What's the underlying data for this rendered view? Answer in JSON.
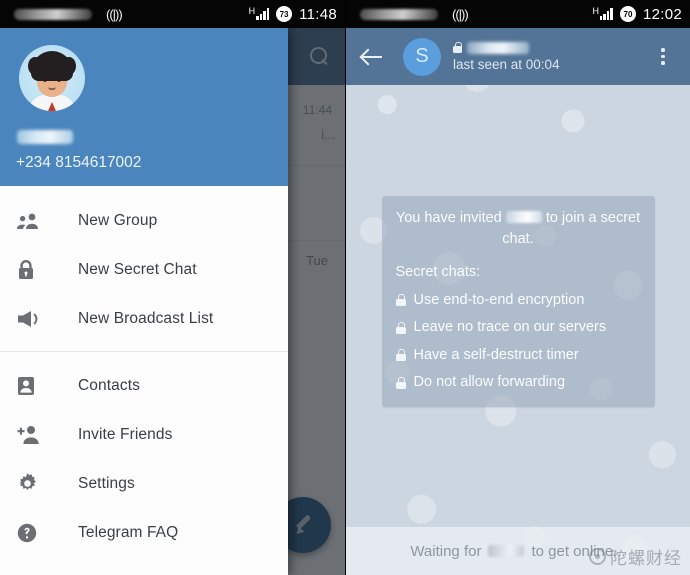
{
  "left_phone": {
    "status_bar": {
      "carrier_blurred": true,
      "wifi_icon": "wifi-icon",
      "network_type": "H",
      "signal_icon": "signal-bars-icon",
      "battery_level": "73",
      "time": "11:48"
    },
    "chat_list": {
      "search_icon": "search-icon",
      "rows": [
        {
          "time": "11:44",
          "snippet": "i..."
        },
        {
          "time": "Tue",
          "snippet": ""
        }
      ],
      "compose_fab_icon": "pencil-icon"
    },
    "drawer": {
      "avatar_icon": "user-avatar",
      "name_blurred": true,
      "phone": "+234 8154617002",
      "items_top": [
        {
          "icon": "group-icon",
          "label": "New Group"
        },
        {
          "icon": "lock-icon",
          "label": "New Secret Chat"
        },
        {
          "icon": "megaphone-icon",
          "label": "New Broadcast List"
        }
      ],
      "items_bottom": [
        {
          "icon": "contact-card-icon",
          "label": "Contacts"
        },
        {
          "icon": "add-person-icon",
          "label": "Invite Friends"
        },
        {
          "icon": "gear-icon",
          "label": "Settings"
        },
        {
          "icon": "question-mark-icon",
          "label": "Telegram FAQ"
        }
      ]
    }
  },
  "right_phone": {
    "status_bar": {
      "carrier_blurred": true,
      "wifi_icon": "wifi-icon",
      "network_type": "H",
      "signal_icon": "signal-bars-icon",
      "battery_level": "70",
      "time": "12:02"
    },
    "chat_header": {
      "back_icon": "back-arrow-icon",
      "avatar_initial": "S",
      "lock_icon": "lock-icon",
      "contact_name_blurred": true,
      "status": "last seen at 00:04",
      "overflow_icon": "more-vertical-icon"
    },
    "service_message": {
      "intro_before": "You have invited",
      "intro_after": "to join a secret chat.",
      "heading": "Secret chats:",
      "bullets": [
        {
          "icon": "lock-icon",
          "text": "Use end-to-end encryption"
        },
        {
          "icon": "lock-icon",
          "text": "Leave no trace on our servers"
        },
        {
          "icon": "lock-icon",
          "text": "Have a self-destruct timer"
        },
        {
          "icon": "lock-icon",
          "text": "Do not allow forwarding"
        }
      ]
    },
    "waiting_bar": {
      "before": "Waiting for",
      "after": "to get online..."
    },
    "watermark": {
      "logo_icon": "circle-logo-icon",
      "text": "陀螺财经"
    }
  },
  "colors": {
    "drawer_header_blue": "#4b85bd",
    "chat_header_blue": "#537496",
    "chatlist_toolbar_blue": "#5b7c9d",
    "chat_background": "#ccd6e0",
    "fab_blue": "#3b6a93",
    "avatar_blue": "#5a9ede"
  }
}
